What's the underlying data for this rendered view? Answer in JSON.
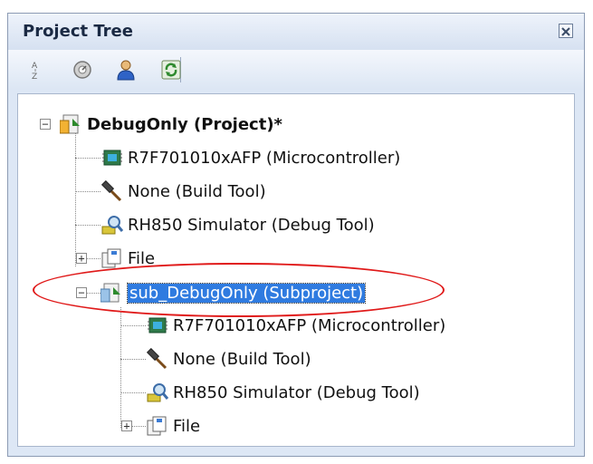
{
  "panel": {
    "title": "Project Tree"
  },
  "toolbar": {
    "buttons": [
      {
        "name": "sort-icon"
      },
      {
        "name": "build-mode-icon"
      },
      {
        "name": "user-icon"
      },
      {
        "name": "refresh-icon"
      }
    ]
  },
  "tree": {
    "root": {
      "label": "DebugOnly (Project)*",
      "expander": "−",
      "children": [
        {
          "label": "R7F701010xAFP (Microcontroller)",
          "icon": "chip-icon"
        },
        {
          "label": "None (Build Tool)",
          "icon": "hammer-icon"
        },
        {
          "label": "RH850 Simulator (Debug Tool)",
          "icon": "debug-tool-icon"
        },
        {
          "label": "File",
          "icon": "file-folder-icon",
          "expander": "+"
        }
      ]
    },
    "subproject": {
      "label": "sub_DebugOnly (Subproject)",
      "expander": "−",
      "selected": true,
      "children": [
        {
          "label": "R7F701010xAFP (Microcontroller)",
          "icon": "chip-icon"
        },
        {
          "label": "None (Build Tool)",
          "icon": "hammer-icon"
        },
        {
          "label": "RH850 Simulator (Debug Tool)",
          "icon": "debug-tool-icon"
        },
        {
          "label": "File",
          "icon": "file-folder-icon",
          "expander": "+"
        }
      ]
    }
  },
  "colors": {
    "selection": "#2f7be0",
    "highlight_ellipse": "#e01919"
  }
}
